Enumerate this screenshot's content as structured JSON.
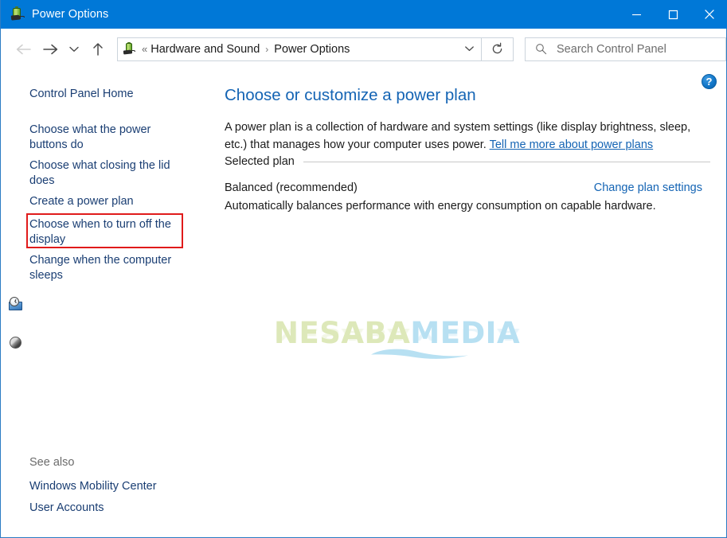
{
  "window": {
    "title": "Power Options",
    "icon": "power-plug-battery-icon",
    "accent_color": "#0078d7",
    "border_color": "#2b7cc4",
    "controls": {
      "minimize": "minimize-icon",
      "maximize": "maximize-icon",
      "close": "close-icon"
    }
  },
  "navbar": {
    "back": "back-arrow-icon",
    "forward": "forward-arrow-icon",
    "recent": "chevron-down-icon",
    "up": "up-arrow-icon",
    "address": {
      "icon": "power-plug-battery-icon",
      "overflow": "«",
      "crumbs": [
        {
          "label": "Hardware and Sound"
        },
        {
          "label": "Power Options"
        }
      ],
      "separator": "›",
      "dropdown": "chevron-down-icon"
    },
    "refresh": "refresh-icon",
    "search": {
      "icon": "search-icon",
      "placeholder": "Search Control Panel",
      "value": ""
    }
  },
  "sidebar": {
    "home_label": "Control Panel Home",
    "links": [
      {
        "label": "Choose what the power buttons do",
        "icon": null
      },
      {
        "label": "Choose what closing the lid does",
        "icon": null
      },
      {
        "label": "Create a power plan",
        "icon": null
      },
      {
        "label": "Choose when to turn off the display",
        "icon": "clock-display-icon",
        "highlighted": true
      },
      {
        "label": "Change when the computer sleeps",
        "icon": "sleep-moon-icon"
      }
    ],
    "see_also": {
      "label": "See also",
      "links": [
        {
          "label": "Windows Mobility Center"
        },
        {
          "label": "User Accounts"
        }
      ]
    },
    "highlight_color": "#e01b1b"
  },
  "main": {
    "help": "?",
    "title": "Choose or customize a power plan",
    "description_part1": "A power plan is a collection of hardware and system settings (like display brightness, sleep, etc.) that manages how your computer uses power. ",
    "description_link": "Tell me more about power plans",
    "group_label": "Selected plan",
    "plan_name": "Balanced (recommended)",
    "plan_action": "Change plan settings",
    "plan_description": "Automatically balances performance with energy consumption on capable hardware."
  },
  "watermark": {
    "part1": "NESABA",
    "part2": "MEDIA",
    "color1": "#dde8b9",
    "color2": "#b7e0f2"
  }
}
